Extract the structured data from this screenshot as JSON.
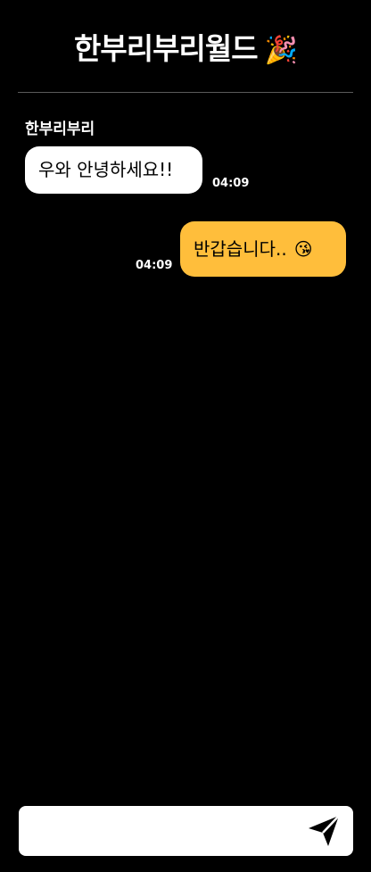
{
  "header": {
    "title": "한부리부리월드",
    "title_emoji": "🎉"
  },
  "messages": [
    {
      "direction": "incoming",
      "sender": "한부리부리",
      "text": "우와 안녕하세요!!",
      "time": "04:09"
    },
    {
      "direction": "outgoing",
      "text": "반갑습니다..",
      "emoji": "😘",
      "time": "04:09"
    }
  ],
  "composer": {
    "value": "",
    "placeholder": "",
    "send_icon": "send-paper-plane-icon"
  },
  "colors": {
    "background": "#000000",
    "incoming_bubble": "#ffffff",
    "outgoing_bubble": "#ffbe3b",
    "divider": "#5a5a5a"
  }
}
